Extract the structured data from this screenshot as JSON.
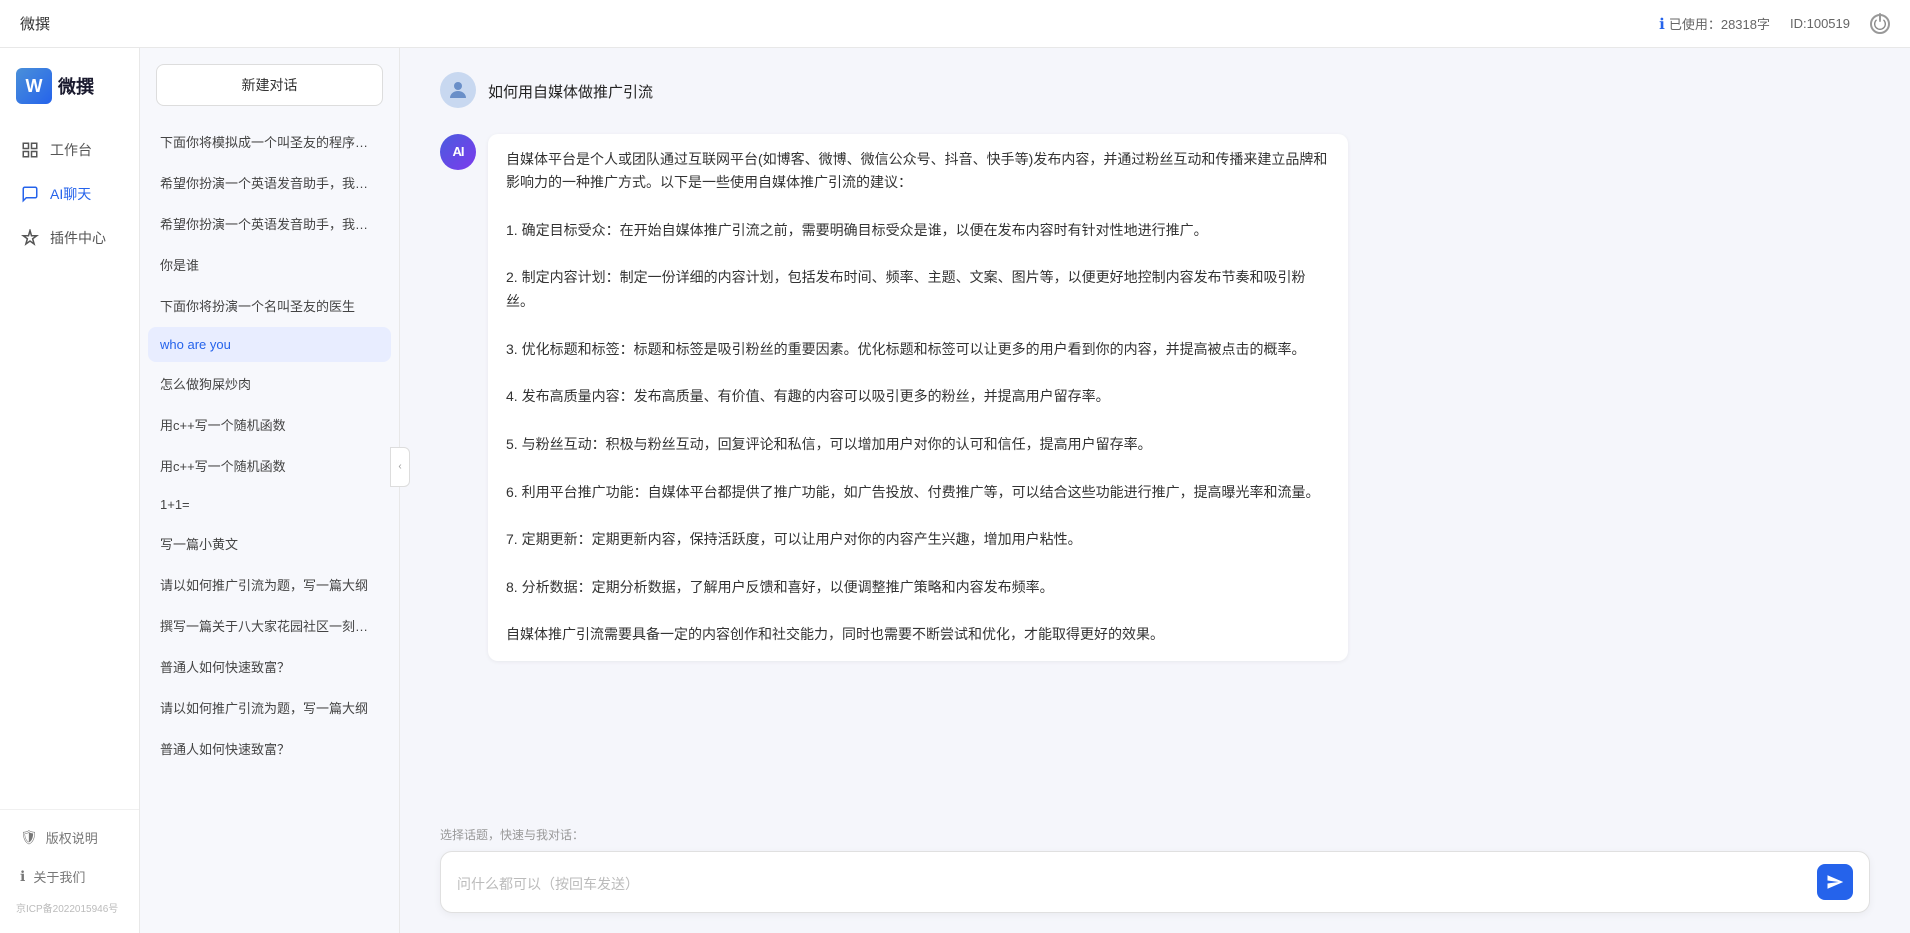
{
  "topbar": {
    "title": "微撰",
    "usage_label": "已使用：28318字",
    "id_label": "ID:100519",
    "usage_icon": "info-icon"
  },
  "leftnav": {
    "logo_text": "微撰",
    "logo_letter": "W",
    "nav_items": [
      {
        "id": "workbench",
        "label": "工作台",
        "icon": "grid-icon"
      },
      {
        "id": "ai-chat",
        "label": "AI聊天",
        "icon": "chat-icon",
        "active": true
      },
      {
        "id": "plugin",
        "label": "插件中心",
        "icon": "plugin-icon"
      }
    ],
    "bottom_items": [
      {
        "id": "copyright",
        "label": "版权说明",
        "icon": "shield-icon"
      },
      {
        "id": "about",
        "label": "关于我们",
        "icon": "info-circle-icon"
      }
    ],
    "icp": "京ICP备2022015946号"
  },
  "sidebar": {
    "new_chat_label": "新建对话",
    "history_items": [
      {
        "id": 1,
        "text": "下面你将模拟成一个叫圣友的程序员，我说...",
        "active": false
      },
      {
        "id": 2,
        "text": "希望你扮演一个英语发音助手，我提供给你...",
        "active": false
      },
      {
        "id": 3,
        "text": "希望你扮演一个英语发音助手，我提供给你...",
        "active": false
      },
      {
        "id": 4,
        "text": "你是谁",
        "active": false
      },
      {
        "id": 5,
        "text": "下面你将扮演一个名叫圣友的医生",
        "active": false
      },
      {
        "id": 6,
        "text": "who are you",
        "active": true
      },
      {
        "id": 7,
        "text": "怎么做狗屎炒肉",
        "active": false
      },
      {
        "id": 8,
        "text": "用c++写一个随机函数",
        "active": false
      },
      {
        "id": 9,
        "text": "用c++写一个随机函数",
        "active": false
      },
      {
        "id": 10,
        "text": "1+1=",
        "active": false
      },
      {
        "id": 11,
        "text": "写一篇小黄文",
        "active": false
      },
      {
        "id": 12,
        "text": "请以如何推广引流为题，写一篇大纲",
        "active": false
      },
      {
        "id": 13,
        "text": "撰写一篇关于八大家花园社区一刻钟便民生...",
        "active": false
      },
      {
        "id": 14,
        "text": "普通人如何快速致富？",
        "active": false
      },
      {
        "id": 15,
        "text": "请以如何推广引流为题，写一篇大纲",
        "active": false
      },
      {
        "id": 16,
        "text": "普通人如何快速致富？",
        "active": false
      }
    ]
  },
  "chat": {
    "messages": [
      {
        "role": "user",
        "text": "如何用自媒体做推广引流",
        "avatar_type": "user"
      },
      {
        "role": "ai",
        "text": "自媒体平台是个人或团队通过互联网平台(如博客、微博、微信公众号、抖音、快手等)发布内容，并通过粉丝互动和传播来建立品牌和影响力的一种推广方式。以下是一些使用自媒体推广引流的建议：\n\n1. 确定目标受众：在开始自媒体推广引流之前，需要明确目标受众是谁，以便在发布内容时有针对性地进行推广。\n\n2. 制定内容计划：制定一份详细的内容计划，包括发布时间、频率、主题、文案、图片等，以便更好地控制内容发布节奏和吸引粉丝。\n\n3. 优化标题和标签：标题和标签是吸引粉丝的重要因素。优化标题和标签可以让更多的用户看到你的内容，并提高被点击的概率。\n\n4. 发布高质量内容：发布高质量、有价值、有趣的内容可以吸引更多的粉丝，并提高用户留存率。\n\n5. 与粉丝互动：积极与粉丝互动，回复评论和私信，可以增加用户对你的认可和信任，提高用户留存率。\n\n6. 利用平台推广功能：自媒体平台都提供了推广功能，如广告投放、付费推广等，可以结合这些功能进行推广，提高曝光率和流量。\n\n7. 定期更新：定期更新内容，保持活跃度，可以让用户对你的内容产生兴趣，增加用户粘性。\n\n8. 分析数据：定期分析数据，了解用户反馈和喜好，以便调整推广策略和内容发布频率。\n\n自媒体推广引流需要具备一定的内容创作和社交能力，同时也需要不断尝试和优化，才能取得更好的效果。",
        "avatar_type": "ai"
      }
    ],
    "input_placeholder": "问什么都可以（按回车发送）",
    "quick_topic_label": "选择话题，快速与我对话："
  }
}
